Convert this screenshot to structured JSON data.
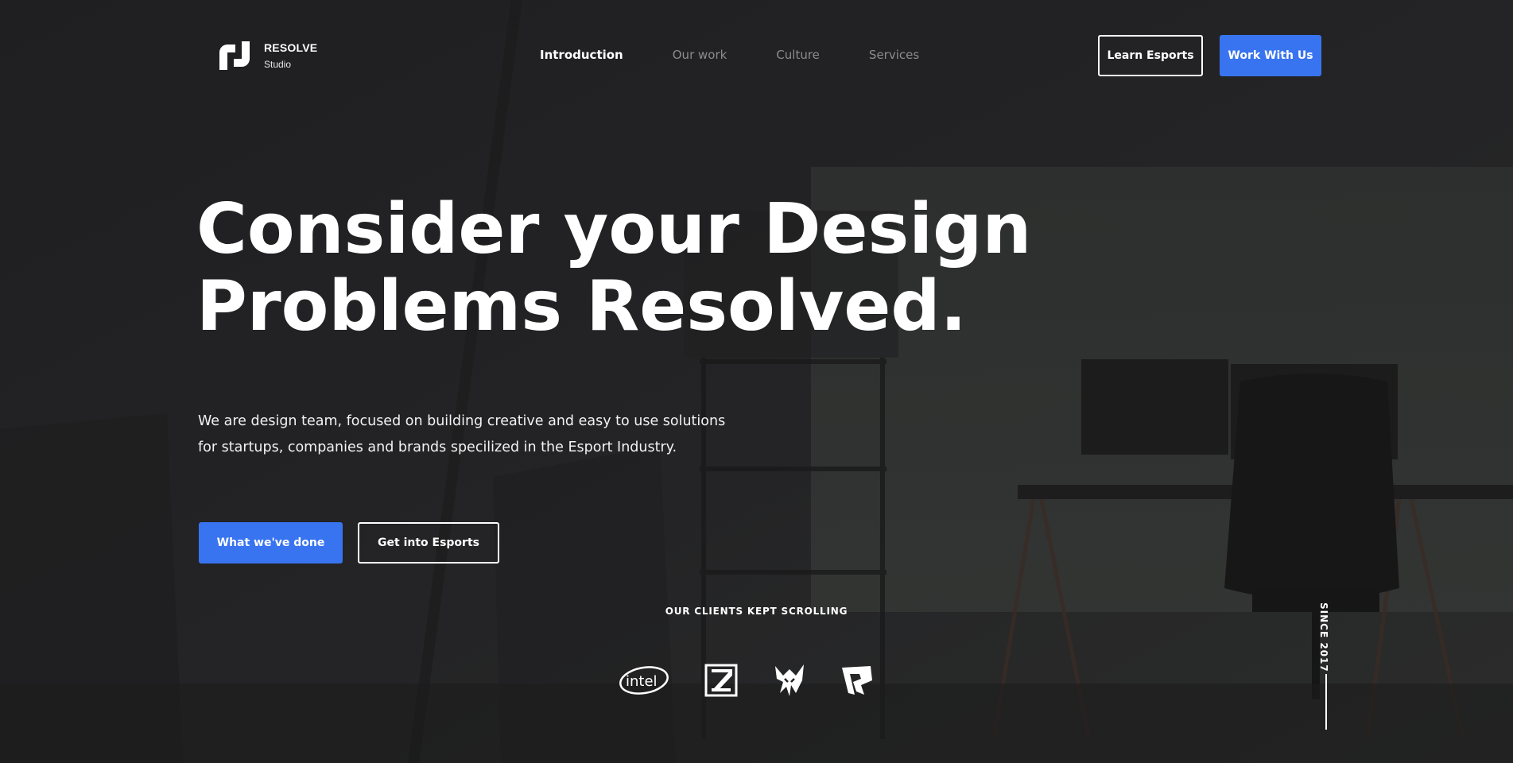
{
  "brand": {
    "name": "RESOLVE",
    "sub": "Studio"
  },
  "nav": [
    {
      "label": "Introduction",
      "active": true
    },
    {
      "label": "Our work",
      "active": false
    },
    {
      "label": "Culture",
      "active": false
    },
    {
      "label": "Services",
      "active": false
    }
  ],
  "header_actions": {
    "learn": "Learn Esports",
    "work": "Work With Us"
  },
  "hero": {
    "line1": "Consider your Design",
    "line2": "Problems Resolved.",
    "lead_line1": "We are design team, focused on building creative and easy to use solutions",
    "lead_line2": "for startups, companies and brands specilized in the Esport Industry."
  },
  "cta": {
    "primary": "What we've done",
    "secondary": "Get into Esports"
  },
  "clients": {
    "title": "OUR CLIENTS KEPT SCROLLING",
    "logos": [
      {
        "name": "intel-logo",
        "text": "intel"
      },
      {
        "name": "z-logo"
      },
      {
        "name": "wolf-logo"
      },
      {
        "name": "r-logo"
      }
    ]
  },
  "since": "SINCE 2017",
  "colors": {
    "accent": "#3874ef",
    "background": "#222224",
    "nav_inactive": "#8c8c8e"
  }
}
